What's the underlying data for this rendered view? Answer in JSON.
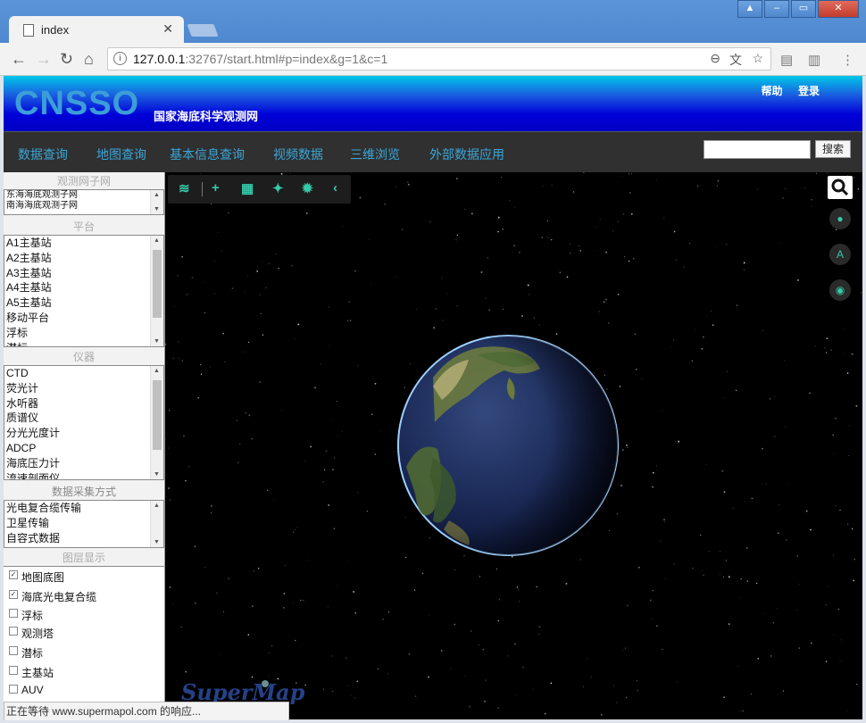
{
  "browser": {
    "tab_title": "index",
    "url_host": "127.0.0.1",
    "url_rest": ":32767/start.html#p=index&g=1&c=1"
  },
  "header": {
    "logo": "CNSSO",
    "subtitle": "国家海底科学观测网",
    "help": "帮助",
    "login": "登录"
  },
  "nav": {
    "items": [
      "数据查询",
      "地图查询",
      "基本信息查询",
      "视频数据",
      "三维浏览",
      "外部数据应用"
    ],
    "search_button": "搜索",
    "search_value": ""
  },
  "panel": {
    "network": {
      "title": "观测网子网",
      "items": [
        "东海海底观测子网",
        "南海海底观测子网"
      ]
    },
    "platform": {
      "title": "平台",
      "items": [
        "A1主基站",
        "A2主基站",
        "A3主基站",
        "A4主基站",
        "A5主基站",
        "移动平台",
        "浮标",
        "潜标"
      ]
    },
    "instrument": {
      "title": "仪器",
      "items": [
        "CTD",
        "荧光计",
        "水听器",
        "质谱仪",
        "分光光度计",
        "ADCP",
        "海底压力计",
        "流速剖面仪"
      ]
    },
    "acquisition": {
      "title": "数据采集方式",
      "items": [
        "光电复合缆传输",
        "卫星传输",
        "自容式数据"
      ]
    },
    "layers": {
      "title": "图层显示",
      "items": [
        {
          "label": "地图底图",
          "checked": true
        },
        {
          "label": "海底光电复合缆",
          "checked": true
        },
        {
          "label": "浮标",
          "checked": false
        },
        {
          "label": "观测塔",
          "checked": false
        },
        {
          "label": "潜标",
          "checked": false
        },
        {
          "label": "主基站",
          "checked": false
        },
        {
          "label": "AUV",
          "checked": false
        }
      ]
    }
  },
  "map": {
    "tool_icons": [
      "layers-icon",
      "plus-icon",
      "grid-icon",
      "sparkle-icon",
      "gear-icon",
      "chevron-left-icon"
    ],
    "right_icons": [
      "search-icon",
      "user-icon",
      "compass-icon",
      "locate-icon"
    ],
    "watermark": "SuperMap"
  },
  "status": "正在等待 www.supermapol.com 的响应..."
}
